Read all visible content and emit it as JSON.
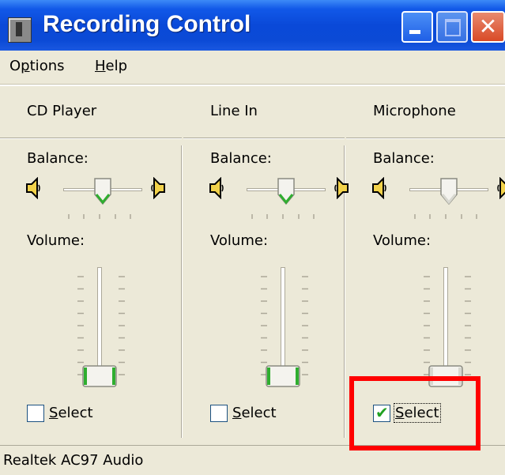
{
  "window": {
    "title": "Recording Control",
    "close_symbol": "✕"
  },
  "menu": {
    "options_label": "Options",
    "help_label": "Help"
  },
  "channels": [
    {
      "name": "CD Player",
      "balance_label": "Balance:",
      "volume_label": "Volume:",
      "select_label": "Select",
      "selected": false,
      "balance": 0.5,
      "volume": 0.05
    },
    {
      "name": "Line In",
      "balance_label": "Balance:",
      "volume_label": "Volume:",
      "select_label": "Select",
      "selected": false,
      "balance": 0.5,
      "volume": 0.05
    },
    {
      "name": "Microphone",
      "balance_label": "Balance:",
      "volume_label": "Volume:",
      "select_label": "Select",
      "selected": true,
      "balance": 0.5,
      "volume": 0.05
    }
  ],
  "status": {
    "device": "Realtek AC97 Audio"
  },
  "icons": {
    "app": "mixer-icon",
    "speaker_left": "speaker-left-icon",
    "speaker_right": "speaker-right-icon",
    "check": "✔"
  },
  "colors": {
    "titlebar": "#0a49d8",
    "face": "#ece9d8",
    "highlight": "#ff0000",
    "check": "#21a121"
  }
}
